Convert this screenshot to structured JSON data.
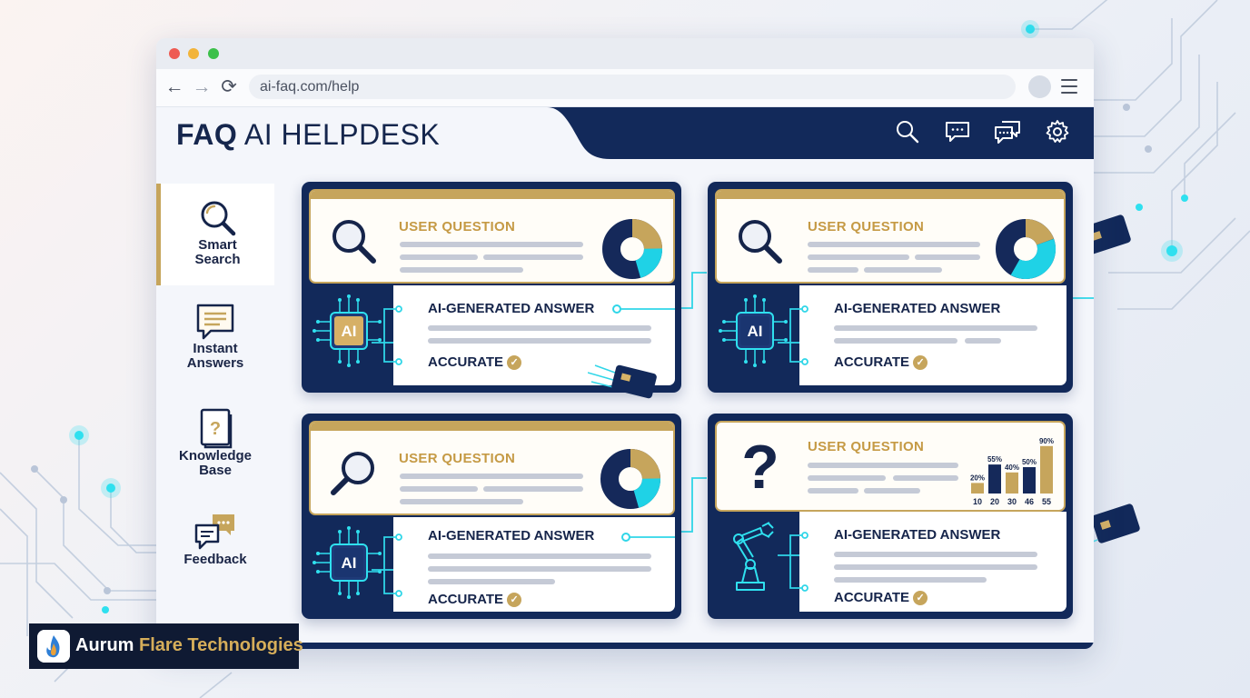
{
  "browser": {
    "url": "ai-faq.com/help",
    "nav": {
      "back": "←",
      "forward": "→",
      "reload": "⟳"
    }
  },
  "app": {
    "title_bold": "FAQ",
    "title_rest": "AI HELPDESK"
  },
  "header_icons": [
    "search-icon",
    "chat-bubble-icon",
    "conversation-icon",
    "gear-icon"
  ],
  "sidebar": {
    "items": [
      {
        "label_1": "Smart",
        "label_2": "Search",
        "icon": "magnifier-icon",
        "active": true
      },
      {
        "label_1": "Instant",
        "label_2": "Answers",
        "icon": "message-icon",
        "active": false
      },
      {
        "label_1": "Knowledge",
        "label_2": "Base",
        "icon": "book-question-icon",
        "active": false
      },
      {
        "label_1": "Feedback",
        "label_2": "",
        "icon": "feedback-bubbles-icon",
        "active": false
      }
    ]
  },
  "cards": [
    {
      "question_label": "USER QUESTION",
      "answer_label": "AI-GENERATED ANSWER",
      "status_label": "ACCURATE",
      "question_icon": "magnifier-icon",
      "answer_icon": "ai-chip-icon",
      "ai_chip_text": "AI",
      "visual": "donut-chart"
    },
    {
      "question_label": "USER QUESTION",
      "answer_label": "AI-GENERATED ANSWER",
      "status_label": "ACCURATE",
      "question_icon": "magnifier-icon",
      "answer_icon": "ai-chip-icon",
      "ai_chip_text": "AI",
      "visual": "donut-chart"
    },
    {
      "question_label": "USER QUESTION",
      "answer_label": "AI-GENERATED ANSWER",
      "status_label": "ACCURATE",
      "question_icon": "magnifier-icon",
      "answer_icon": "ai-chip-icon",
      "ai_chip_text": "AI",
      "visual": "donut-chart"
    },
    {
      "question_label": "USER QUESTION",
      "answer_label": "AI-GENERATED ANSWER",
      "status_label": "ACCURATE",
      "question_icon": "question-mark-icon",
      "answer_icon": "robot-arm-icon",
      "visual": "bar-chart"
    }
  ],
  "mini_bar_chart": {
    "categories": [
      "10",
      "20",
      "30",
      "46",
      "55"
    ],
    "labels": [
      "20%",
      "55%",
      "40%",
      "50%",
      "90%"
    ],
    "values": [
      20,
      55,
      40,
      50,
      90
    ],
    "colors": [
      "#c6a55c",
      "#15295a",
      "#c6a55c",
      "#15295a",
      "#c6a55c"
    ]
  },
  "brand": {
    "name_1": "Aurum",
    "name_2": "Flare Technologies"
  },
  "colors": {
    "navy": "#12295a",
    "gold": "#c6a55c",
    "cyan": "#1fd2e6",
    "text_dark": "#15244a"
  }
}
